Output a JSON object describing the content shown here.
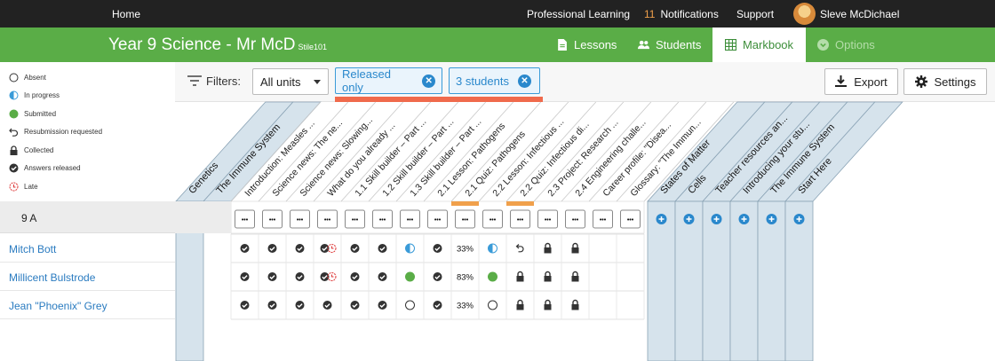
{
  "topbar": {
    "home": "Home",
    "professional_learning": "Professional Learning",
    "notifications_count": "11",
    "notifications_label": "Notifications",
    "support": "Support",
    "user_name": "Sleve McDichael"
  },
  "header": {
    "title": "Year 9 Science - Mr McD",
    "subtitle": "Stile101",
    "tabs": {
      "lessons": "Lessons",
      "students": "Students",
      "markbook": "Markbook",
      "options": "Options"
    }
  },
  "legend": [
    {
      "key": "absent",
      "label": "Absent"
    },
    {
      "key": "in_progress",
      "label": "In progress"
    },
    {
      "key": "submitted",
      "label": "Submitted"
    },
    {
      "key": "resubmission",
      "label": "Resubmission requested"
    },
    {
      "key": "collected",
      "label": "Collected"
    },
    {
      "key": "answers_released",
      "label": "Answers released"
    },
    {
      "key": "late",
      "label": "Late"
    }
  ],
  "filters": {
    "label": "Filters:",
    "unit_select": "All units",
    "chips": [
      "Released only",
      "3 students"
    ],
    "export": "Export",
    "settings": "Settings"
  },
  "colors": {
    "green": "#5aad47",
    "blue": "#2a88cc",
    "accent": "#f06a4c",
    "highlight": "#f0a04b",
    "column": "#d6e3ec"
  },
  "columns_left": [
    "Genetics",
    "The Immune System"
  ],
  "lessons": [
    "Introduction: Measles ...",
    "Science news: The ne...",
    "Science news: Slowing...",
    "What do you already ...",
    "1.1 Skill builder – Part ...",
    "1.2 Skill builder – Part ...",
    "1.3 Skill builder – Part ...",
    "2.1 Lesson: Pathogens",
    "2.1 Quiz: Pathogens",
    "2.2 Lesson: Infectious ...",
    "2.2 Quiz: Infectious di...",
    "2.3 Project: Research ...",
    "2.4 Engineering challe...",
    "Career profile: \"Disea...",
    "Glossary: \"The Immun..."
  ],
  "lesson_highlights": [
    8,
    10
  ],
  "columns_right": [
    "States of Matter",
    "Cells",
    "Teacher resources an...",
    "Introducing your stu...",
    "The Immune System",
    "Start Here"
  ],
  "group": {
    "name": "9 A"
  },
  "more_label": "•••",
  "students": [
    {
      "name": "Mitch Bott",
      "marks": [
        "check",
        "check",
        "check",
        "check_late",
        "check",
        "check",
        "half",
        "check",
        "33%",
        "half",
        "resub",
        "lock",
        "lock",
        "",
        ""
      ]
    },
    {
      "name": "Millicent Bulstrode",
      "marks": [
        "check",
        "check",
        "check",
        "check_late",
        "check",
        "check",
        "green",
        "check",
        "83%",
        "green",
        "lock",
        "lock",
        "lock",
        "",
        ""
      ]
    },
    {
      "name": "Jean \"Phoenix\" Grey",
      "marks": [
        "check",
        "check",
        "check",
        "check",
        "check",
        "check",
        "empty",
        "check",
        "33%",
        "empty",
        "lock",
        "lock",
        "lock",
        "",
        ""
      ]
    }
  ]
}
